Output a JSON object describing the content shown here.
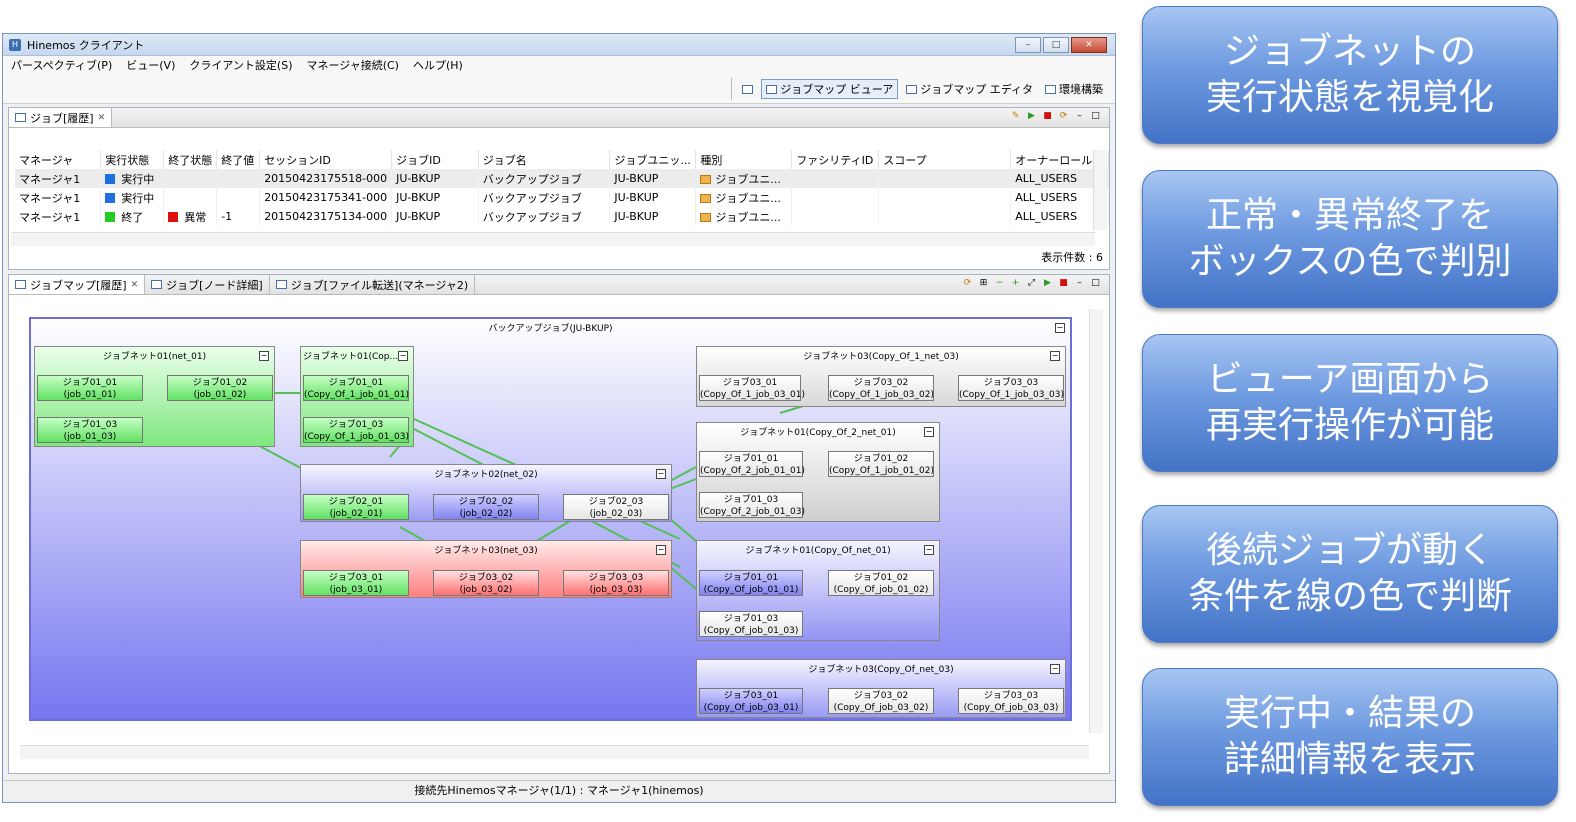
{
  "window": {
    "title": "Hinemos クライアント",
    "min": "–",
    "max": "□",
    "close": "✕"
  },
  "menu": [
    "パースペクティブ(P)",
    "ビュー(V)",
    "クライアント設定(S)",
    "マネージャ接続(C)",
    "ヘルプ(H)"
  ],
  "perspectives": [
    "ジョブマップ ビューア",
    "ジョブマップ エディタ",
    "環境構築"
  ],
  "history": {
    "tab": "ジョブ[履歴]",
    "columns": [
      "マネージャ",
      "実行状態",
      "終了状態",
      "終了値",
      "セッションID",
      "ジョブID",
      "ジョブ名",
      "ジョブユニッ...",
      "種別",
      "ファシリティID",
      "スコープ",
      "オーナーロールID"
    ],
    "rows": [
      {
        "manager": "マネージャ1",
        "run_color": "#1f6fe0",
        "run": "実行中",
        "end_color": "",
        "end": "",
        "val": "",
        "session": "20150423175518-000",
        "jobid": "JU-BKUP",
        "name": "バックアップジョブ",
        "unit": "JU-BKUP",
        "kind": "ジョブユニ...",
        "fac": "",
        "scope": "",
        "owner": "ALL_USERS"
      },
      {
        "manager": "マネージャ1",
        "run_color": "#1f6fe0",
        "run": "実行中",
        "end_color": "",
        "end": "",
        "val": "",
        "session": "20150423175341-000",
        "jobid": "JU-BKUP",
        "name": "バックアップジョブ",
        "unit": "JU-BKUP",
        "kind": "ジョブユニ...",
        "fac": "",
        "scope": "",
        "owner": "ALL_USERS"
      },
      {
        "manager": "マネージャ1",
        "run_color": "#22cc22",
        "run": "終了",
        "end_color": "#e01010",
        "end": "異常",
        "val": "-1",
        "session": "20150423175134-000",
        "jobid": "JU-BKUP",
        "name": "バックアップジョブ",
        "unit": "JU-BKUP",
        "kind": "ジョブユニ...",
        "fac": "",
        "scope": "",
        "owner": "ALL_USERS"
      }
    ],
    "count": "表示件数 : 6"
  },
  "map_tabs": [
    "ジョブマップ[履歴]",
    "ジョブ[ノード詳細]",
    "ジョブ[ファイル転送](マネージャ2)"
  ],
  "map": {
    "unit": "バックアップジョブ(JU-BKUP)",
    "net01": {
      "title": "ジョブネット01(net_01)",
      "j1": [
        "ジョブ01_01",
        "(job_01_01)"
      ],
      "j2": [
        "ジョブ01_02",
        "(job_01_02)"
      ],
      "j3": [
        "ジョブ01_03",
        "(job_01_03)"
      ]
    },
    "net01c": {
      "title": "ジョブネット01(Cop...",
      "j1": [
        "ジョブ01_01",
        "(Copy_Of_1_job_01_01)"
      ],
      "j3": [
        "ジョブ01_03",
        "(Copy_Of_1_job_01_03)"
      ]
    },
    "net02": {
      "title": "ジョブネット02(net_02)",
      "j1": [
        "ジョブ02_01",
        "(job_02_01)"
      ],
      "j2": [
        "ジョブ02_02",
        "(job_02_02)"
      ],
      "j3": [
        "ジョブ02_03",
        "(job_02_03)"
      ]
    },
    "net03": {
      "title": "ジョブネット03(net_03)",
      "j1": [
        "ジョブ03_01",
        "(job_03_01)"
      ],
      "j2": [
        "ジョブ03_02",
        "(job_03_02)"
      ],
      "j3": [
        "ジョブ03_03",
        "(job_03_03)"
      ]
    },
    "c1n03": {
      "title": "ジョブネット03(Copy_Of_1_net_03)",
      "j1": [
        "ジョブ03_01",
        "(Copy_Of_1_job_03_01)"
      ],
      "j2": [
        "ジョブ03_02",
        "(Copy_Of_1_job_03_02)"
      ],
      "j3": [
        "ジョブ03_03",
        "(Copy_Of_1_job_03_03)"
      ]
    },
    "c2n01": {
      "title": "ジョブネット01(Copy_Of_2_net_01)",
      "j1": [
        "ジョブ01_01",
        "(Copy_Of_2_job_01_01)"
      ],
      "j2": [
        "ジョブ01_02",
        "(Copy_Of_1_job_01_02)"
      ],
      "j3": [
        "ジョブ01_03",
        "(Copy_Of_2_job_01_03)"
      ]
    },
    "cn01": {
      "title": "ジョブネット01(Copy_Of_net_01)",
      "j1": [
        "ジョブ01_01",
        "(Copy_Of_job_01_01)"
      ],
      "j2": [
        "ジョブ01_02",
        "(Copy_Of_job_01_02)"
      ],
      "j3": [
        "ジョブ01_03",
        "(Copy_Of_job_01_03)"
      ]
    },
    "cn03": {
      "title": "ジョブネット03(Copy_Of_net_03)",
      "j1": [
        "ジョブ03_01",
        "(Copy_Of_job_03_01)"
      ],
      "j2": [
        "ジョブ03_02",
        "(Copy_Of_job_03_02)"
      ],
      "j3": [
        "ジョブ03_03",
        "(Copy_Of_job_03_03)"
      ]
    }
  },
  "statusbar": "接続先Hinemosマネージャ(1/1) : マネージャ1(hinemos)",
  "callouts": [
    [
      "ジョブネットの",
      "実行状態を視覚化"
    ],
    [
      "正常・異常終了を",
      "ボックスの色で判別"
    ],
    [
      "ビューア画面から",
      "再実行操作が可能"
    ],
    [
      "後続ジョブが動く",
      "条件を線の色で判断"
    ],
    [
      "実行中・結果の",
      "詳細情報を表示"
    ]
  ]
}
